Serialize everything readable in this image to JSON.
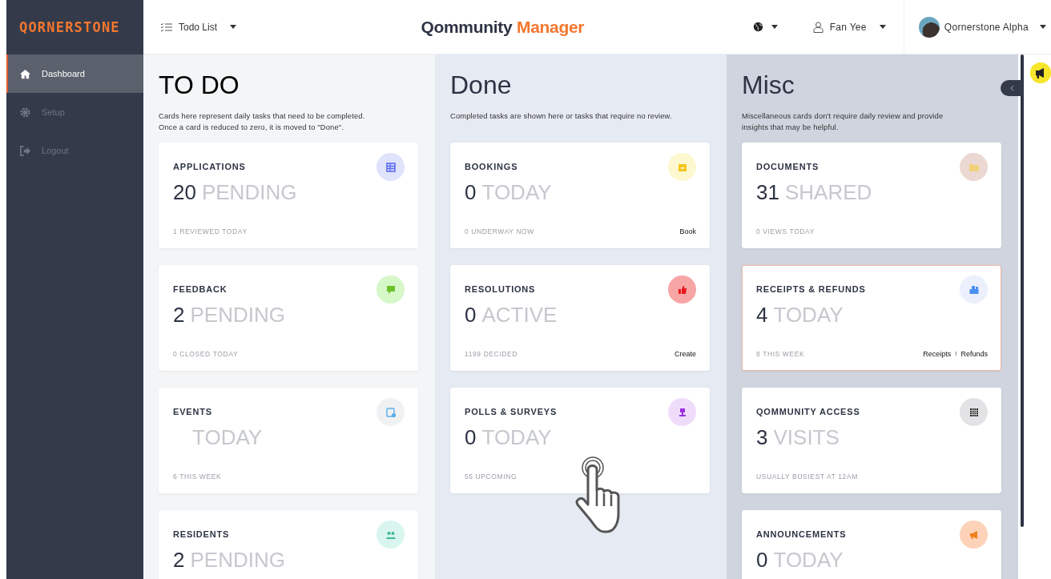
{
  "sidebar": {
    "logo": "QORNERSTONE",
    "items": [
      {
        "label": "Dashboard",
        "kind": "home",
        "selected": true
      },
      {
        "label": "Setup",
        "kind": "gear",
        "selected": false
      },
      {
        "label": "Logout",
        "kind": "logout",
        "selected": false
      }
    ]
  },
  "header": {
    "view_selector": "Todo List",
    "title": "Qommunity",
    "title_accent": "Manager",
    "user": "Fan Yee",
    "organization": "Qornerstone Alpha"
  },
  "columns": [
    {
      "title": "TO DO",
      "description": "Cards here represent daily tasks that need to be completed.\nOnce a card is reduced to zero, it is moved to \"Done\".",
      "cards": [
        {
          "title": "APPLICATIONS",
          "count": "20",
          "unit": "PENDING",
          "footer": "1 REVIEWED TODAY",
          "kind": "table",
          "color": "#dfe3fb",
          "selected": false
        },
        {
          "title": "FEEDBACK",
          "count": "2",
          "unit": "PENDING",
          "footer": "0 CLOSED TODAY",
          "kind": "chat",
          "color": "#d6f7c8",
          "selected": false
        },
        {
          "title": "EVENTS",
          "unit": "TODAY",
          "footer": "6 THIS WEEK",
          "kind": "calendar",
          "color": "#f0f1f3",
          "selected": false
        },
        {
          "title": "RESIDENTS",
          "count": "2",
          "unit": "PENDING",
          "kind": "people",
          "color": "#d8f6ee",
          "selected": false
        }
      ]
    },
    {
      "title": "Done",
      "description": "Completed tasks are shown here or tasks that require no review.",
      "cards": [
        {
          "title": "BOOKINGS",
          "count": "0",
          "unit": "TODAY",
          "footer": "0 UNDERWAY NOW",
          "kind": "box",
          "color": "#fdf8cf",
          "selected": false,
          "actions": [
            {
              "kind": "link",
              "text": "Book"
            }
          ]
        },
        {
          "title": "RESOLUTIONS",
          "count": "0",
          "unit": "ACTIVE",
          "footer": "1199 DECIDED",
          "kind": "thumb",
          "color": "#f8a5a5",
          "selected": false,
          "actions": [
            {
              "kind": "link",
              "text": "Create"
            }
          ]
        },
        {
          "title": "POLLS & SURVEYS",
          "count": "0",
          "unit": "TODAY",
          "footer": "55 UPCOMING",
          "kind": "poll",
          "color": "#efdcfb",
          "selected": false
        }
      ]
    },
    {
      "title": "Misc",
      "description": "Miscellaneous cards don't require daily review and provide\ninsights that may be helpful.",
      "cards": [
        {
          "title": "DOCUMENTS",
          "count": "31",
          "unit": "SHARED",
          "footer": "0 VIEWS TODAY",
          "kind": "folder",
          "color": "#ecd8d2",
          "selected": false
        },
        {
          "title": "RECEIPTS & REFUNDS",
          "count": "4",
          "unit": "TODAY",
          "footer": "8 THIS WEEK",
          "kind": "register",
          "color": "#eceffc",
          "selected": true,
          "actions": [
            {
              "kind": "link",
              "text": "Receipts"
            },
            {
              "kind": "separator",
              "text": "I"
            },
            {
              "kind": "link",
              "text": "Refunds"
            }
          ]
        },
        {
          "title": "QOMMUNITY ACCESS",
          "count": "3",
          "unit": "VISITS",
          "footer": "USUALLY BUSIEST AT 12AM",
          "kind": "grid",
          "color": "#e3e3e5",
          "selected": false
        },
        {
          "title": "ANNOUNCEMENTS",
          "count": "0",
          "unit": "TODAY",
          "kind": "megaphone",
          "color": "#fdd2b8",
          "selected": false
        }
      ]
    }
  ]
}
